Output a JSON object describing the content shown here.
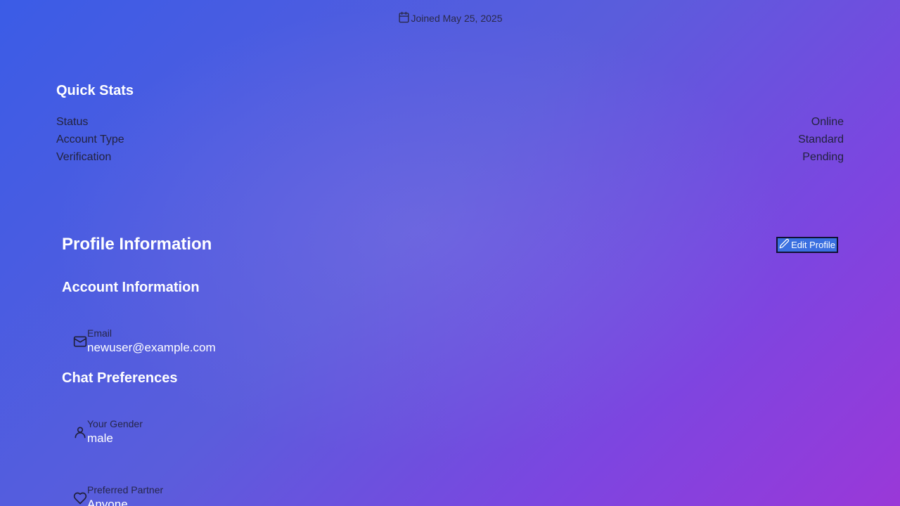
{
  "header": {
    "joined_text": "Joined May 25, 2025",
    "joined_icon": "calendar-icon"
  },
  "quick_stats": {
    "title": "Quick Stats",
    "rows": [
      {
        "label": "Status",
        "value": "Online"
      },
      {
        "label": "Account Type",
        "value": "Standard"
      },
      {
        "label": "Verification",
        "value": "Pending"
      }
    ]
  },
  "profile": {
    "title": "Profile Information",
    "edit_button_label": "Edit Profile",
    "edit_button_icon": "pencil-icon",
    "account_section": {
      "title": "Account Information",
      "email": {
        "label": "Email",
        "value": "newuser@example.com",
        "icon": "mail-icon"
      }
    },
    "chat_section": {
      "title": "Chat Preferences",
      "gender": {
        "label": "Your Gender",
        "value": "male",
        "icon": "user-icon"
      },
      "partner": {
        "label": "Preferred Partner",
        "value": "Anyone",
        "icon": "heart-icon"
      }
    }
  },
  "colors": {
    "gradient_start": "#3b5ce6",
    "gradient_end": "#9a38d8",
    "edit_button_bg": "#3a6fe0"
  }
}
